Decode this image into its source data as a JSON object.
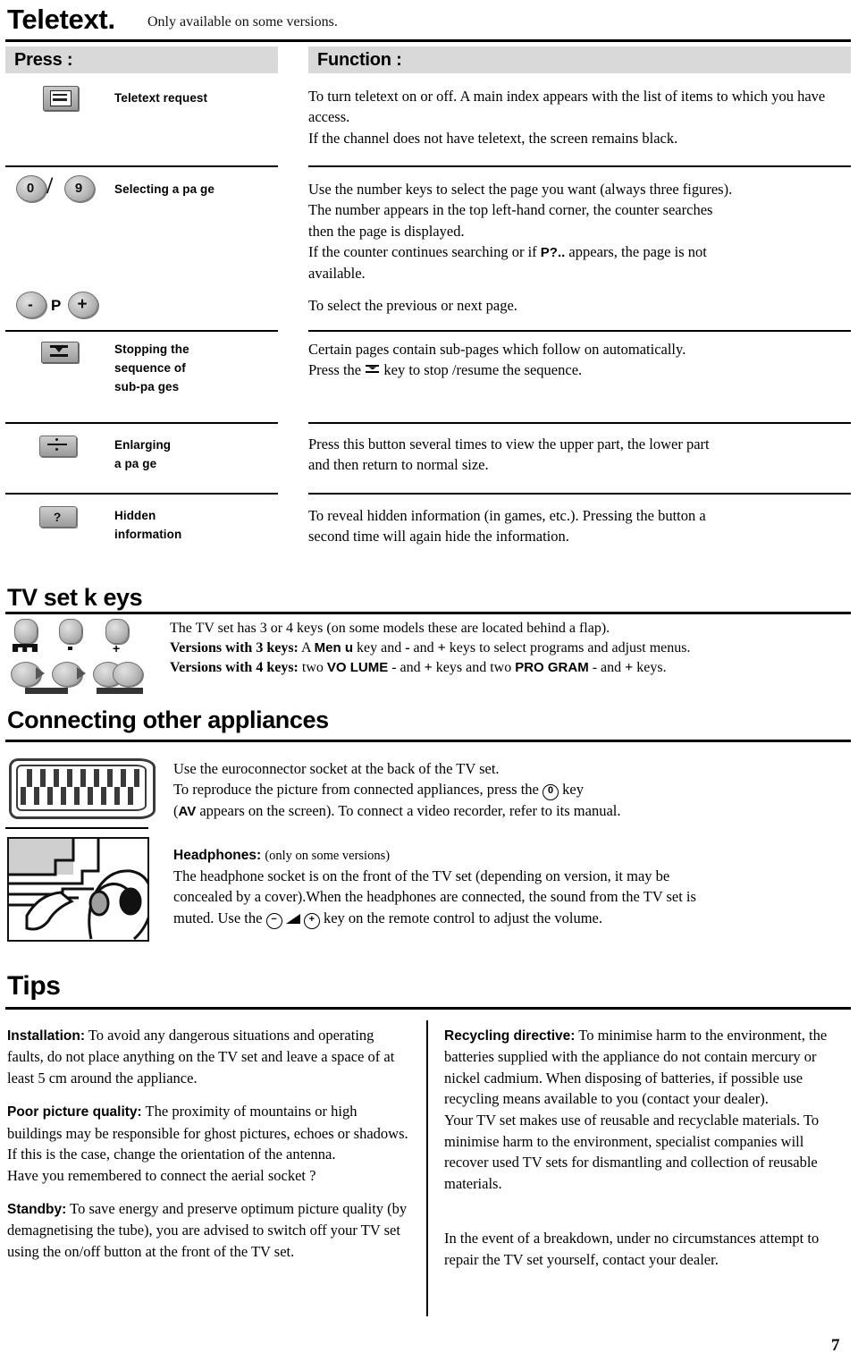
{
  "document": {
    "title": "Teletext.",
    "title_note": "Only available on some versions.",
    "page_number": "7"
  },
  "table": {
    "header_press": "Press :",
    "header_function": "Function :",
    "rows": [
      {
        "icon": "teletext-request-key-icon",
        "label": "Teletext request",
        "function_lines": [
          "To turn teletext on or off. A main index appears with the list of items to",
          "which you have access.",
          "If the channel does not have teletext, the screen remains black."
        ]
      },
      {
        "icon": "number-keys-0-9-icon",
        "icon2": "program-minus-plus-key-icon",
        "label": "Selecting a pa   ge",
        "function_lines": [
          "Use the number keys to select the page you want (always three figures).",
          "The number appears in the top left-hand corner, the counter searches",
          "then the page is displayed."
        ],
        "function_line_bold_prefix": "If the counter continues searching or if ",
        "function_line_bold": "P?..",
        "function_line_bold_suffix": " appears, the page is not",
        "function_line_bold_cont": "available.",
        "function_last": "To select the previous or next page."
      },
      {
        "icon": "stop-subpage-key-icon",
        "label_lines": [
          "Stopping the",
          "sequence of",
          "sub-pa ges"
        ],
        "function_line1": "Certain pages contain sub-pages which follow on automatically.",
        "function_line2_pre": "Press the ",
        "function_line2_icon": "stop-subpage-inline-icon",
        "function_line2_post": " key to stop /resume the sequence."
      },
      {
        "icon": "enlarge-page-key-icon",
        "label_lines": [
          "Enlarging",
          "a pa ge"
        ],
        "function_lines": [
          "Press this button several times to view the upper part, the lower part",
          "and then return to normal size."
        ]
      },
      {
        "icon": "hidden-information-key-icon",
        "label_lines": [
          "Hidden",
          "information"
        ],
        "function_lines": [
          "To reveal hidden information (in games, etc.). Pressing the button a",
          "second time will again hide the information."
        ]
      }
    ]
  },
  "tv_set_keys": {
    "heading": "TV set k  eys",
    "icon_3keys": "tv-three-keys-icon",
    "icon_4keys": "tv-four-keys-icon",
    "line1": "The TV set has 3 or 4 keys (on some models these are located behind a flap).",
    "line2_label": "Versions with 3 keys:",
    "line2_a": " A ",
    "line2_menu": "Men u",
    "line2_b": " key and ",
    "line2_minus": "-",
    "line2_c": " and ",
    "line2_plus": "+",
    "line2_d": " keys to select programs and adjust menus.",
    "line3_label": "Versions with 4 keys:",
    "line3_a": " two ",
    "line3_volume": "VO LUME",
    "line3_b": " - and ",
    "line3_plus1": "+",
    "line3_c": " keys and two ",
    "line3_program": "PRO GRAM",
    "line3_d": " - and ",
    "line3_plus2": "+",
    "line3_e": " keys."
  },
  "connecting": {
    "heading": "Connecting other appliances",
    "icon": "euroconnector-scart-socket-icon",
    "line1": "Use the euroconnector socket at the back of the TV set.",
    "line2_pre": "To reproduce the picture from connected appliances, press the ",
    "line2_key": "0",
    "line2_post": " key",
    "line3_pre": "(",
    "line3_av": "AV",
    "line3_post": " appears on the screen). To connect a video recorder, refer to its manual."
  },
  "headphones": {
    "icon": "headphones-illustration-icon",
    "heading": "Headphones:",
    "note": "(only on some versions)",
    "line1": "The headphone socket is on the front of the TV set (depending on version, it may be",
    "line2": "concealed by a cover).When the headphones are connected, the sound from the TV set is",
    "line3_pre": "muted. Use the ",
    "line3_minus_key": "−",
    "line3_vol_icon": "volume-triangle-icon",
    "line3_plus_key": "+",
    "line3_post": " key on the remote control to adjust the volume."
  },
  "tips": {
    "heading": "Tips",
    "left": [
      {
        "head": "Installation:",
        "body": " To avoid any dangerous situations and operating faults, do not place anything on the TV set and leave a space of at least 5 cm around the appliance."
      },
      {
        "head": "Poor picture quality:",
        "body": " The proximity of mountains or high buildings may be responsible for ghost pictures, echoes or shadows. If this is the case, change the orientation of the antenna.",
        "body2": "Have you remembered to connect the aerial socket ?"
      },
      {
        "head": "Standby:",
        "body": " To save energy and preserve optimum picture quality (by demagnetising the tube), you are advised to switch off your TV set using the on/off button at the front of the TV set."
      }
    ],
    "right": [
      {
        "head": "Recycling directive:",
        "body": " To minimise harm to the environment, the batteries supplied with the appliance do not contain mercury or nickel cadmium. When disposing of batteries, if possible use recycling means available to you (contact your dealer).",
        "body2": "Your TV set makes use of reusable and recyclable materials. To minimise harm to the environment, specialist companies will recover used TV sets for dismantling and collection of reusable materials."
      },
      {
        "head": "",
        "body": "In the event of a breakdown, under no circumstances attempt to repair the TV set yourself, contact your dealer."
      }
    ]
  },
  "colors": {
    "band_grey": "#d9d9d9",
    "rule_black": "#000000",
    "key_grey": "#b0b0b0"
  }
}
